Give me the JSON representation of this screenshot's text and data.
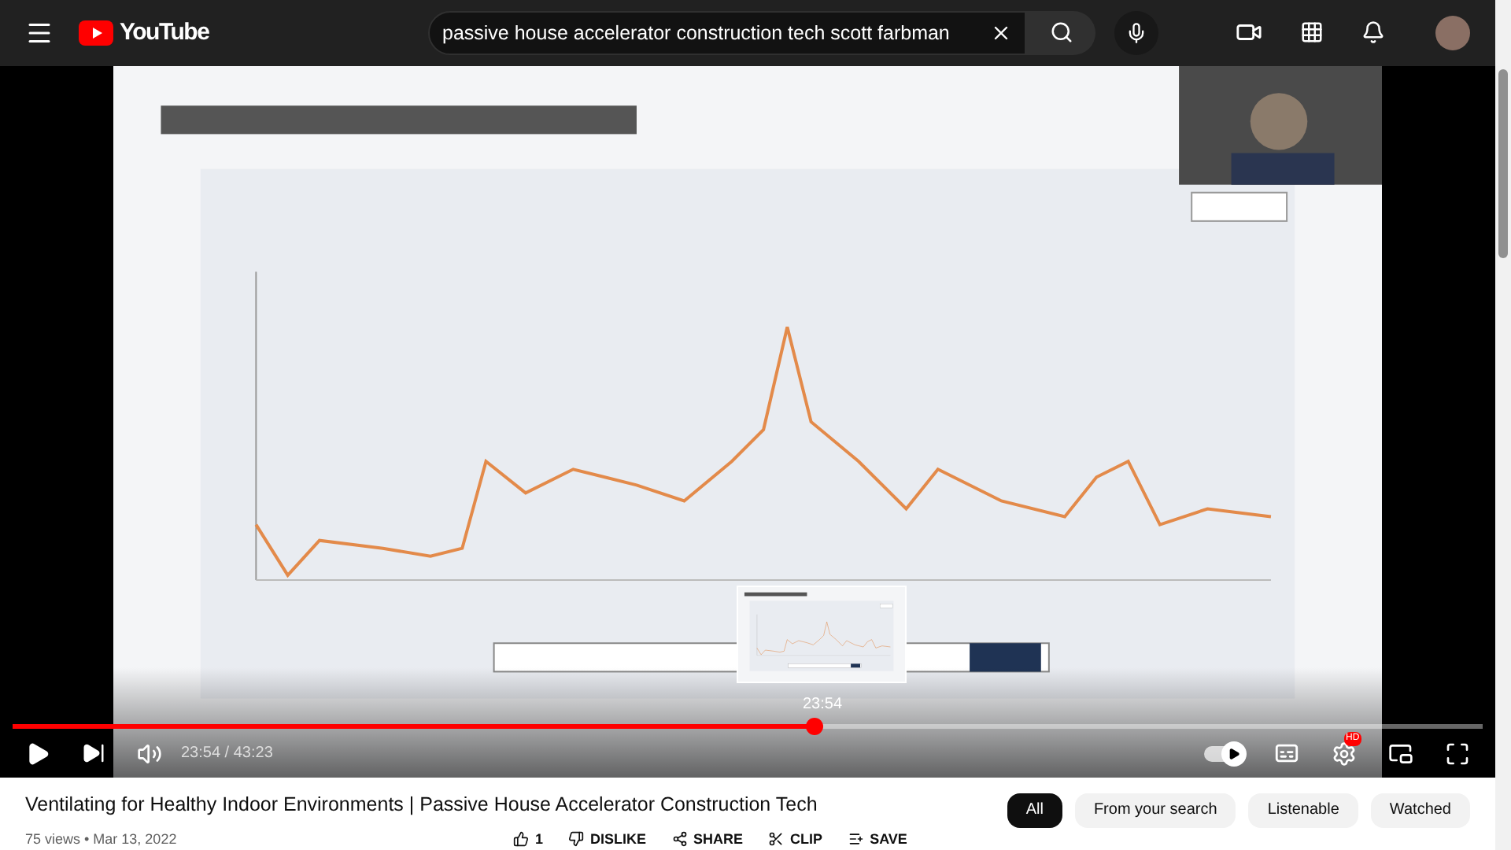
{
  "header": {
    "logo": "YouTube",
    "search": {
      "value": "passive house accelerator construction tech scott farbman"
    }
  },
  "player": {
    "preview": {
      "time": "23:54"
    },
    "progress": {
      "level": 0.545
    },
    "time": "23:54 / 43:23",
    "autoplay_on": true,
    "quality_badge": "HD"
  },
  "video_title": "Ventilating for Healthy Indoor Environments | Passive House Accelerator Construction Tech",
  "meta": "75 views • Mar 13, 2022",
  "actions": [
    {
      "kind": "like",
      "label": "1"
    },
    {
      "kind": "dislike",
      "label": "DISLIKE"
    },
    {
      "kind": "share",
      "label": "SHARE"
    },
    {
      "kind": "clip",
      "label": "CLIP"
    },
    {
      "kind": "save",
      "label": "SAVE"
    }
  ],
  "chips": [
    {
      "label": "All",
      "selected": true
    },
    {
      "label": "From your search",
      "selected": false
    },
    {
      "label": "Listenable",
      "selected": false
    },
    {
      "label": "Watched",
      "selected": false
    }
  ]
}
